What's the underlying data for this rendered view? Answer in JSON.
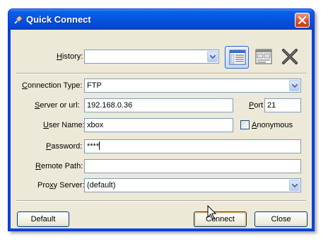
{
  "window": {
    "title": "Quick Connect",
    "title_icon": "plug-icon",
    "close_icon": "close-icon"
  },
  "history": {
    "label_underline": "H",
    "label_rest": "istory:",
    "value": "",
    "tool_buttons": [
      "site-manager-icon",
      "session-list-icon",
      "delete-icon"
    ]
  },
  "connection_type": {
    "label_underline": "C",
    "label_rest": "onnection Type:",
    "value": "FTP"
  },
  "server": {
    "label_underline": "S",
    "label_rest": "erver or url:",
    "value": "192.168.0.36"
  },
  "port": {
    "label_underline": "P",
    "label_rest": "ort",
    "value": "21"
  },
  "user_name": {
    "label_underline": "U",
    "label_rest": "ser Name:",
    "value": "xbox"
  },
  "anonymous": {
    "label_underline": "A",
    "label_rest": "nonymous",
    "checked": false
  },
  "password": {
    "label_underline": "P",
    "label_rest": "assword:",
    "value": "****"
  },
  "remote_path": {
    "label_underline": "R",
    "label_rest": "emote Path:",
    "value": ""
  },
  "proxy": {
    "label_pre": "Pro",
    "label_underline": "x",
    "label_rest": "y Server:",
    "value": "(default)"
  },
  "buttons": {
    "default": "Default",
    "connect": "Connect",
    "close": "Close"
  },
  "colors": {
    "title_bar": "#0553e0",
    "client_bg": "#ece9d8",
    "input_border": "#7f9db9"
  }
}
